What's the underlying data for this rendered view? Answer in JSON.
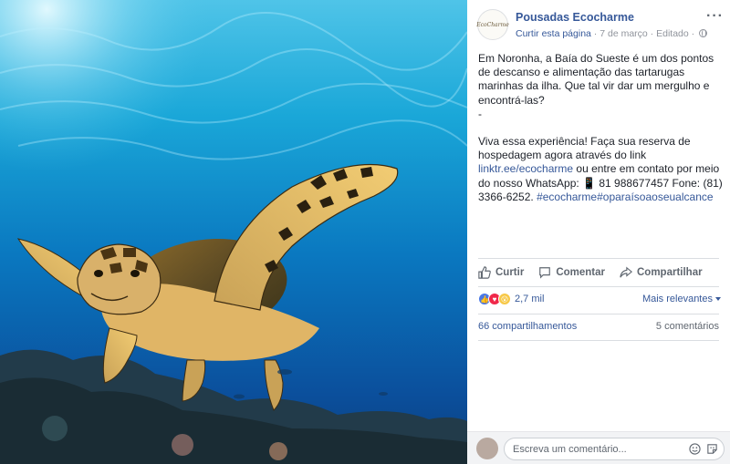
{
  "photo": {
    "alt_icon": "sea-turtle-photo"
  },
  "post": {
    "page_name": "Pousadas Ecocharme",
    "avatar_text": "EcoCharme",
    "like_page": "Curtir esta página",
    "separator1": " · ",
    "date": "7 de março",
    "separator2": " · ",
    "edited": "Editado",
    "separator3": " · ",
    "more_icon": "more-dots-icon",
    "text": {
      "para1": "Em Noronha, a Baía do Sueste é um dos pontos de descanso e alimentação das tartarugas marinhas da ilha. Que tal vir dar um mergulho e encontrá-las?",
      "dash": "-",
      "para2_a": "Viva essa experiência! Faça sua reserva de hospedagem agora através do link ",
      "link1": "linktr.ee/ecocharme",
      "para2_b": " ou entre em contato por meio do nosso WhatsApp: ",
      "phone_emoji": "📱",
      "para2_c": " 81 988677457 Fone: (81) 3366-6252. ",
      "hashtag1": "#ecocharme",
      "hashtag2": "#oparaísoaoseualcance"
    }
  },
  "actions": {
    "like": "Curtir",
    "comment": "Comentar",
    "share": "Compartilhar"
  },
  "reactions": {
    "count": "2,7 mil",
    "sort": "Mais relevantes"
  },
  "stats": {
    "shares": "66 compartilhamentos",
    "comments": "5 comentários"
  },
  "comment_box": {
    "placeholder": "Escreva um comentário..."
  },
  "colors": {
    "link": "#365899",
    "muted": "#90949c",
    "like": "#4a78e6",
    "love": "#f0284a",
    "wow": "#f7c846"
  }
}
